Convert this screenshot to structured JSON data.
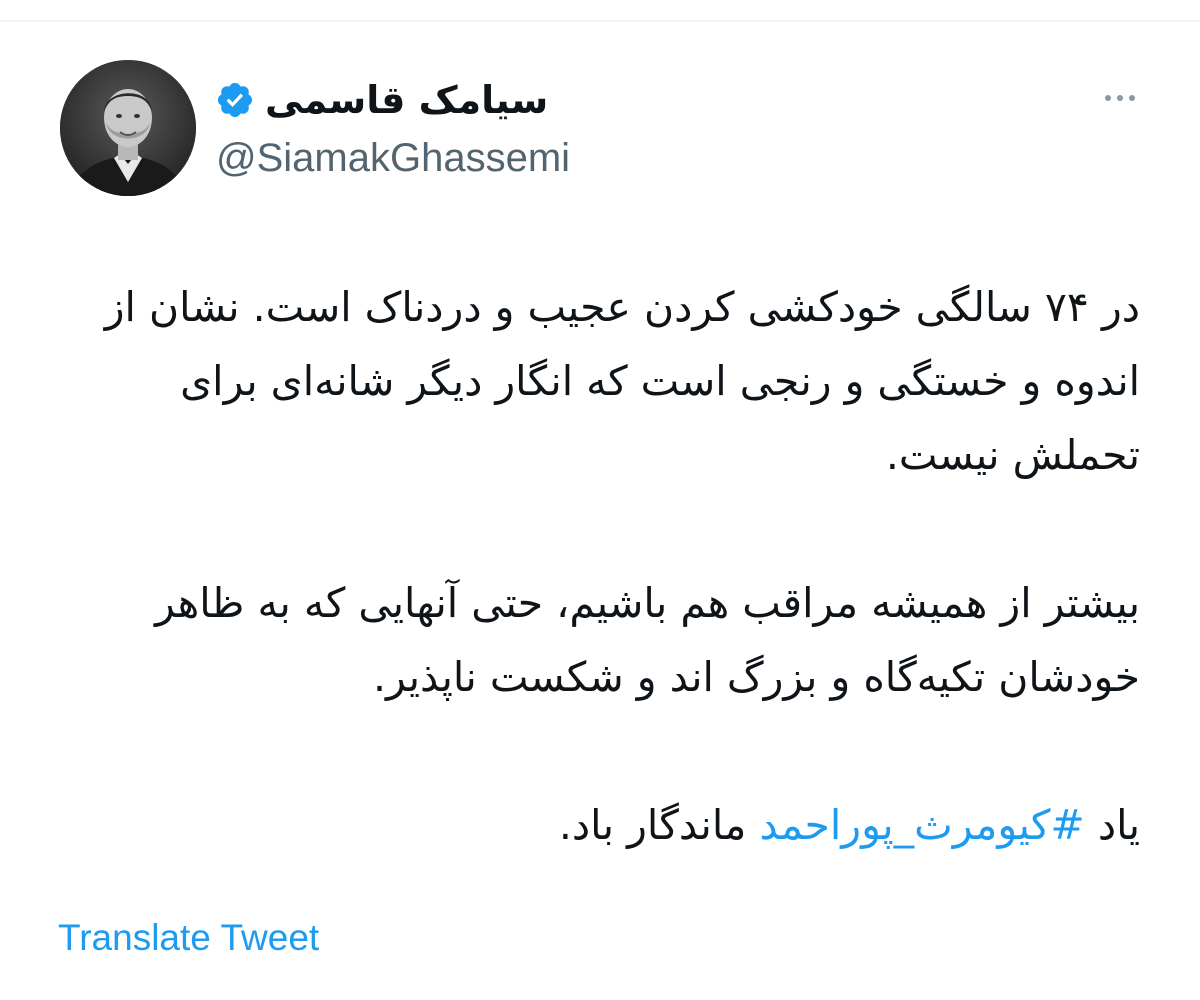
{
  "tweet": {
    "author": {
      "display_name": "سیامک قاسمی",
      "handle": "@SiamakGhassemi",
      "verified": true,
      "verified_icon": "verified-badge-icon"
    },
    "more_icon": "more-horizontal-icon",
    "paragraphs": [
      "در ۷۴ سالگی خودکشی کردن عجیب و دردناک است. نشان از اندوه و خستگی و رنجی است که انگار دیگر شانه‌ای برای تحملش نیست.",
      "بیشتر از همیشه مراقب هم باشیم، حتی آنهایی که به ظاهر خودشان تکیه‌گاه و بزرگ اند و شکست ناپذیر."
    ],
    "last_paragraph": {
      "before": "یاد ",
      "hashtag": "#کیومرث_پوراحمد",
      "after": " ماندگار باد."
    },
    "translate_label": "Translate Tweet"
  },
  "colors": {
    "text": "#0f1419",
    "secondary": "#536471",
    "link": "#1d9bf0",
    "divider": "#eff3f4"
  }
}
